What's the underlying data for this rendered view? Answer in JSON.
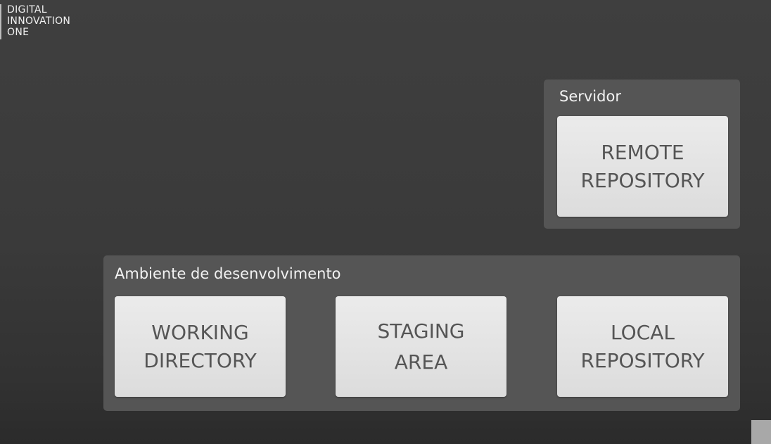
{
  "brand": {
    "lines": [
      "DIGITAL",
      "INNOVATION",
      "ONE"
    ]
  },
  "servidor": {
    "label": "Servidor",
    "boxes": [
      {
        "label": "REMOTE\nREPOSITORY"
      }
    ]
  },
  "ambiente": {
    "label": "Ambiente de desenvolvimento",
    "boxes": [
      {
        "label": "WORKING\nDIRECTORY"
      },
      {
        "label": "STAGING\nAREA"
      },
      {
        "label": "LOCAL\nREPOSITORY"
      }
    ]
  }
}
